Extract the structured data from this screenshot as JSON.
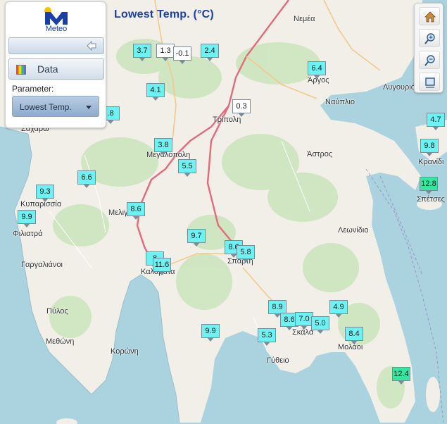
{
  "title": "Lowest Temp. (°C)",
  "panel": {
    "logo_text": "Meteo",
    "data_button": "Data",
    "parameter_label": "Parameter:",
    "parameter_value": "Lowest Temp."
  },
  "toolbar": {
    "icons": [
      "home-icon",
      "zoom-in-icon",
      "zoom-out-icon",
      "full-extent-icon"
    ]
  },
  "colors": {
    "marker_cyan": "#6cf2f2",
    "marker_white": "#ffffff",
    "marker_green": "#35e6a0",
    "title": "#1a3fa8",
    "sea": "#aad3df",
    "land": "#f2efe9"
  },
  "stations": [
    {
      "value": "3.7",
      "c": "cyan"
    },
    {
      "value": "1.3",
      "c": "white"
    },
    {
      "value": "-0.1",
      "c": "white"
    },
    {
      "value": "2.4",
      "c": "cyan"
    },
    {
      "value": "6.4",
      "c": "cyan"
    },
    {
      "value": "4.1",
      "c": "cyan"
    },
    {
      "value": "0.3",
      "c": "white"
    },
    {
      "value": ".8",
      "c": "cyan"
    },
    {
      "value": "4.7",
      "c": "cyan"
    },
    {
      "value": "3.8",
      "c": "cyan"
    },
    {
      "value": "9.8",
      "c": "cyan"
    },
    {
      "value": "5.5",
      "c": "cyan"
    },
    {
      "value": "6.6",
      "c": "cyan"
    },
    {
      "value": "12.8",
      "c": "green"
    },
    {
      "value": "9.3",
      "c": "cyan"
    },
    {
      "value": "8.6",
      "c": "cyan"
    },
    {
      "value": "9.9",
      "c": "cyan"
    },
    {
      "value": "9.7",
      "c": "cyan"
    },
    {
      "value": "8.6",
      "c": "cyan"
    },
    {
      "value": "5.8",
      "c": "cyan"
    },
    {
      "value": "8",
      "c": "cyan"
    },
    {
      "value": "11.6",
      "c": "cyan"
    },
    {
      "value": "8.9",
      "c": "cyan"
    },
    {
      "value": "4.9",
      "c": "cyan"
    },
    {
      "value": "8.6",
      "c": "cyan"
    },
    {
      "value": "7.0",
      "c": "cyan"
    },
    {
      "value": "5.0",
      "c": "cyan"
    },
    {
      "value": "9.9",
      "c": "cyan"
    },
    {
      "value": "5.3",
      "c": "cyan"
    },
    {
      "value": "8.4",
      "c": "cyan"
    },
    {
      "value": "12.4",
      "c": "green"
    }
  ],
  "places": [
    "Νεμέα",
    "Άργος",
    "Λυγουριό",
    "Ναύπλιο",
    "Τρίπολη",
    "Άστρος",
    "Κρανίδι",
    "Σπέτσες",
    "Μεγαλόπολη",
    "Κυπαρισσία",
    "Μελιγαλάς",
    "Φιλιατρά",
    "Λεωνίδιο",
    "Γαργαλιάνοι",
    "Καλαμάτα",
    "Σπάρτη",
    "Πύλος",
    "Σκάλα",
    "Μεθώνη",
    "Κορώνη",
    "Μολάοι",
    "Γύθειο",
    "Ζαχάρω"
  ]
}
